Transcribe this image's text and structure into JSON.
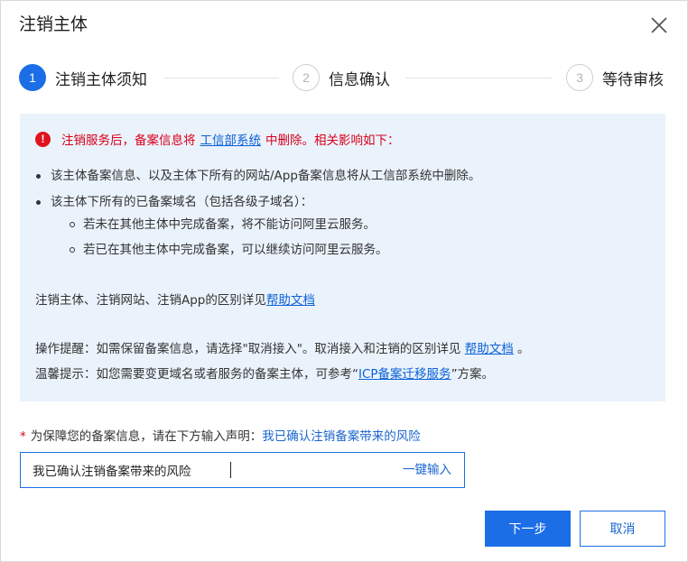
{
  "dialog": {
    "title": "注销主体",
    "close_icon": "close-icon"
  },
  "steps": [
    {
      "number": "1",
      "label": "注销主体须知",
      "state": "active"
    },
    {
      "number": "2",
      "label": "信息确认",
      "state": "inactive"
    },
    {
      "number": "3",
      "label": "等待审核",
      "state": "inactive"
    }
  ],
  "notice": {
    "warning_prefix": "注销服务后，备案信息将",
    "warning_link": "工信部系统",
    "warning_suffix": "中删除。相关影响如下：",
    "bullets": [
      "该主体备案信息、以及主体下所有的网站/App备案信息将从工信部系统中删除。",
      "该主体下所有的已备案域名（包括各级子域名）："
    ],
    "sub_bullets": [
      "若未在其他主体中完成备案，将不能访问阿里云服务。",
      "若已在其他主体中完成备案，可以继续访问阿里云服务。"
    ],
    "diff_text": "注销主体、注销网站、注销App的区别详见",
    "diff_link": "帮助文档",
    "reminder_text": "操作提醒：如需保留备案信息，请选择\"取消接入\"。取消接入和注销的区别详见",
    "reminder_link": "帮助文档",
    "reminder_end": "。",
    "tip_prefix": "温馨提示：如您需要变更域名或者服务的备案主体，可参考“",
    "tip_link": "ICP备案迁移服务",
    "tip_suffix": "”方案。"
  },
  "statement": {
    "required_mark": "*",
    "label": "为保障您的备案信息，请在下方输入声明：",
    "phrase": "我已确认注销备案带来的风险",
    "input_value": "我已确认注销备案带来的风险",
    "one_click": "一键输入"
  },
  "buttons": {
    "next": "下一步",
    "cancel": "取消"
  },
  "colors": {
    "primary": "#1c6ee6",
    "danger": "#d9001b",
    "notice_bg": "#eaf2fb"
  }
}
